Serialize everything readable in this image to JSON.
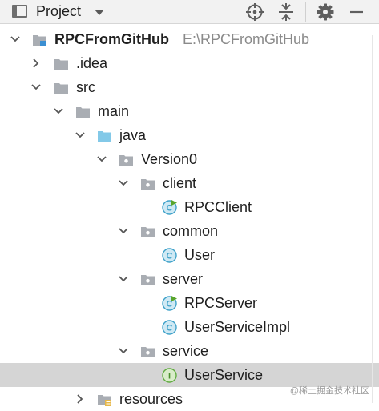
{
  "toolwindow": {
    "title": "Project",
    "icons": [
      "project-view-icon",
      "dropdown-caret-icon",
      "locate-icon",
      "collapse-all-icon",
      "gear-icon",
      "minimize-icon"
    ]
  },
  "tree": {
    "project": {
      "name": "RPCFromGitHub",
      "path": "E:\\RPCFromGitHub"
    },
    "idea": ".idea",
    "src": "src",
    "main": "main",
    "java": "java",
    "version0": "Version0",
    "client": "client",
    "rpc_client": "RPCClient",
    "common": "common",
    "user": "User",
    "server": "server",
    "rpc_server": "RPCServer",
    "user_service_impl": "UserServiceImpl",
    "service": "service",
    "user_service": "UserService",
    "resources": "resources"
  },
  "watermark": "@稀土掘金技术社区",
  "colors": {
    "folder": "#a9adb3",
    "source_folder": "#83c9e8",
    "class_icon": "#3ea1c9",
    "interface_icon": "#5fab3f",
    "run_marker": "#59a52c",
    "selection": "#d5d5d5"
  }
}
